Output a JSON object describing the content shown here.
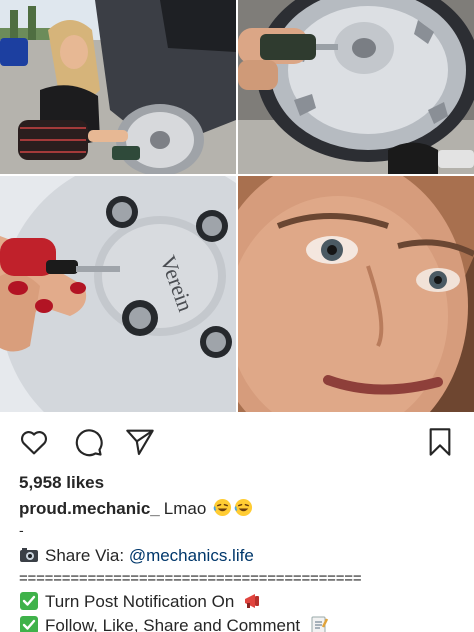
{
  "post": {
    "likes_text": "5,958 likes",
    "username": "proud.mechanic_",
    "caption": "Lmao",
    "dash": "-",
    "share_label": "Share Via:",
    "share_handle": "@mechanics.life",
    "separator": "========================================",
    "notify_text": "Turn Post Notification On",
    "follow_text": "Follow, Like, Share and Comment"
  },
  "photos": {
    "wheel_badge_text": "Verein"
  },
  "icons": {
    "like": "heart-icon",
    "comment": "comment-bubble-icon",
    "share": "paper-plane-icon",
    "save": "bookmark-icon",
    "laugh": "laughing-emoji-icon",
    "camera": "camera-emoji-icon",
    "check": "check-mark-icon",
    "megaphone": "megaphone-emoji-icon",
    "memo": "memo-emoji-icon"
  }
}
